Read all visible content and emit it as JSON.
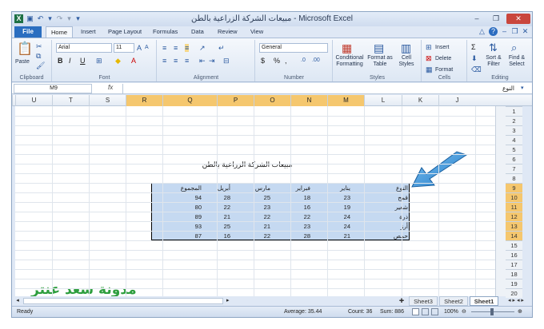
{
  "window": {
    "title": "مبيعات الشركة الزراعية بالطن - Microsoft Excel",
    "minimize": "–",
    "restore": "❐",
    "close": "✕"
  },
  "tabs": [
    "File",
    "Home",
    "Insert",
    "Page Layout",
    "Formulas",
    "Data",
    "Review",
    "View"
  ],
  "ribbon": {
    "clipboard": {
      "paste": "Paste",
      "label": "Clipboard"
    },
    "font": {
      "name": "Arial",
      "size": "11",
      "label": "Font",
      "bold": "B",
      "italic": "I",
      "underline": "U"
    },
    "alignment": {
      "label": "Alignment"
    },
    "number": {
      "format": "General",
      "label": "Number",
      "currency": "$",
      "percent": "%",
      "comma": ","
    },
    "styles": {
      "conditional": "Conditional Formatting",
      "format_table": "Format as Table",
      "cell_styles": "Cell Styles",
      "label": "Styles"
    },
    "cells": {
      "insert": "Insert",
      "delete": "Delete",
      "format": "Format",
      "label": "Cells"
    },
    "editing": {
      "sort": "Sort & Filter",
      "find": "Find & Select",
      "label": "Editing",
      "sigma": "Σ"
    }
  },
  "formula_bar": {
    "name_box": "M9",
    "fx": "fx",
    "value": "النوع"
  },
  "columns": [
    "U",
    "T",
    "S",
    "R",
    "Q",
    "P",
    "O",
    "N",
    "M",
    "L",
    "K",
    "J"
  ],
  "selected_columns": [
    "R",
    "Q",
    "P",
    "O",
    "N",
    "M"
  ],
  "rows": [
    "1",
    "2",
    "3",
    "4",
    "5",
    "6",
    "7",
    "8",
    "9",
    "10",
    "11",
    "12",
    "13",
    "14",
    "15",
    "16",
    "17",
    "18",
    "19",
    "20"
  ],
  "selected_rows": [
    "9",
    "10",
    "11",
    "12",
    "13",
    "14"
  ],
  "sheet": {
    "title": "مبيعات الشركة الزراعية بالطن",
    "headers": [
      "النوع",
      "يناير",
      "فبراير",
      "مارس",
      "أبريل",
      "المجموع"
    ],
    "rows": [
      [
        "قمح",
        "23",
        "18",
        "25",
        "28",
        "94"
      ],
      [
        "شعير",
        "19",
        "16",
        "23",
        "22",
        "80"
      ],
      [
        "ذرة",
        "24",
        "22",
        "22",
        "21",
        "89"
      ],
      [
        "أرز",
        "24",
        "23",
        "21",
        "25",
        "93"
      ],
      [
        "حمص",
        "21",
        "28",
        "22",
        "16",
        "87"
      ]
    ]
  },
  "watermark": "مدونة سعد عنتر",
  "sheet_tabs": [
    "Sheet1",
    "Sheet2",
    "Sheet3"
  ],
  "active_sheet": "Sheet1",
  "status": {
    "ready": "Ready",
    "average": "Average: 35.44",
    "count": "Count: 36",
    "sum": "Sum: 886",
    "zoom": "100%"
  }
}
